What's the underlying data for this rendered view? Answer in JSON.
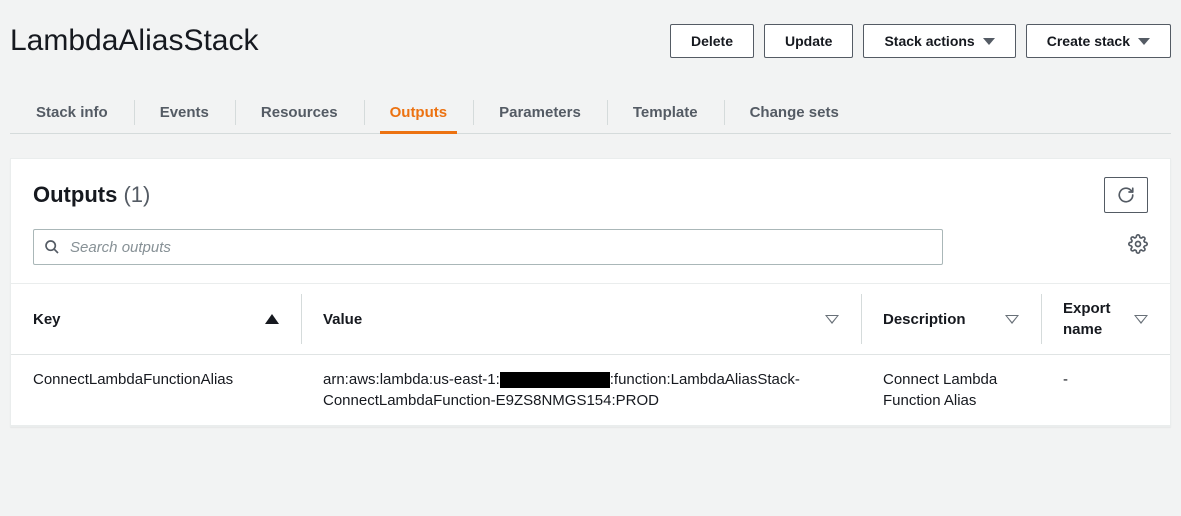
{
  "header": {
    "title": "LambdaAliasStack",
    "buttons": {
      "delete": "Delete",
      "update": "Update",
      "stack_actions": "Stack actions",
      "create_stack": "Create stack"
    }
  },
  "tabs": [
    {
      "label": "Stack info",
      "active": false
    },
    {
      "label": "Events",
      "active": false
    },
    {
      "label": "Resources",
      "active": false
    },
    {
      "label": "Outputs",
      "active": true
    },
    {
      "label": "Parameters",
      "active": false
    },
    {
      "label": "Template",
      "active": false
    },
    {
      "label": "Change sets",
      "active": false
    }
  ],
  "outputs_panel": {
    "title": "Outputs",
    "count": "(1)",
    "search_placeholder": "Search outputs",
    "columns": {
      "key": "Key",
      "value": "Value",
      "description": "Description",
      "export_name": "Export name"
    },
    "rows": [
      {
        "key": "ConnectLambdaFunctionAlias",
        "value_pre": "arn:aws:lambda:us-east-1:",
        "value_post": ":function:LambdaAliasStack-ConnectLambdaFunction-E9ZS8NMGS154:PROD",
        "description": "Connect Lambda Function Alias",
        "export_name": "-"
      }
    ]
  }
}
